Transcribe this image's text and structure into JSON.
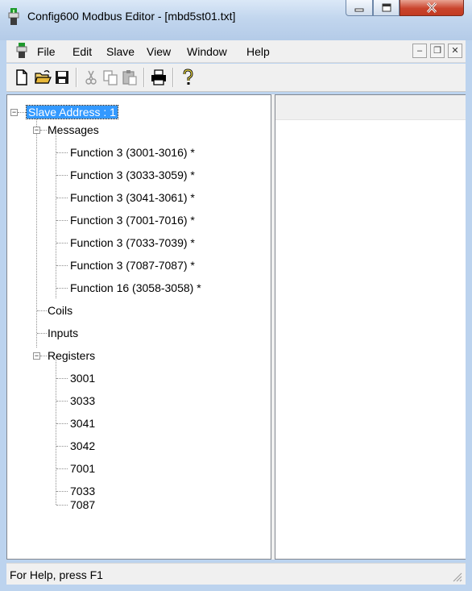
{
  "window": {
    "title": "Config600 Modbus Editor - [mbd5st01.txt]",
    "controls": {
      "minimize": "minimize",
      "maximize": "maximize",
      "close": "close"
    }
  },
  "menu": {
    "items": [
      "File",
      "Edit",
      "Slave",
      "View",
      "Window",
      "Help"
    ]
  },
  "toolbar": {
    "buttons": [
      "new-icon",
      "open-icon",
      "save-icon",
      "cut-icon",
      "copy-icon",
      "paste-icon",
      "print-icon",
      "help-icon"
    ]
  },
  "tree": {
    "root": "Slave Address : 1",
    "messages_label": "Messages",
    "messages": [
      "Function 3 (3001-3016) *",
      "Function 3 (3033-3059) *",
      "Function 3 (3041-3061) *",
      "Function 3 (7001-7016) *",
      "Function 3 (7033-7039) *",
      "Function 3 (7087-7087) *",
      "Function 16 (3058-3058) *"
    ],
    "coils_label": "Coils",
    "inputs_label": "Inputs",
    "registers_label": "Registers",
    "registers": [
      "3001",
      "3033",
      "3041",
      "3042",
      "7001",
      "7033",
      "7087"
    ]
  },
  "status": {
    "text": "For Help, press F1"
  },
  "colors": {
    "selection": "#3399ff",
    "titlebar": "#c2d6ee",
    "close_button": "#c9442d"
  }
}
